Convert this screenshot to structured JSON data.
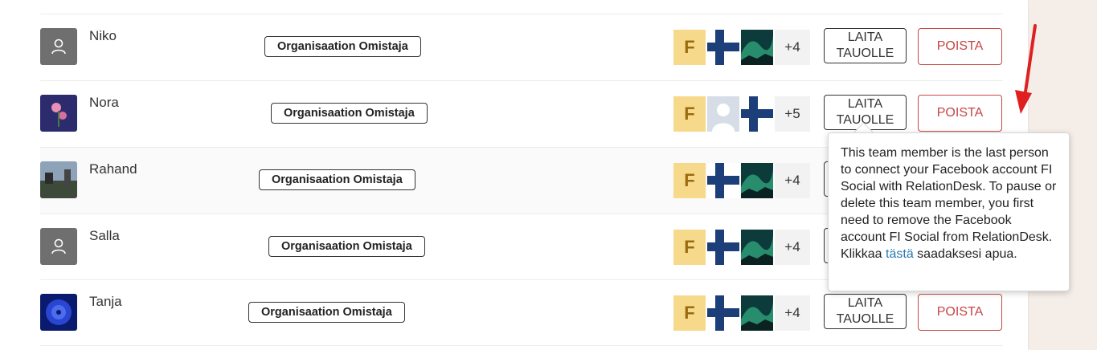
{
  "members": [
    {
      "name": "Niko",
      "avatar": "default-avatar",
      "role": "Organisaation Omistaja",
      "more": "+4",
      "accounts": [
        "facebook-f",
        "finland-flag",
        "aurora-image"
      ],
      "pause_label_1": "LAITA",
      "pause_label_2": "TAUOLLE",
      "delete_label": "POISTA"
    },
    {
      "name": "Nora",
      "avatar": "flower-photo",
      "role": "Organisaation Omistaja",
      "more": "+5",
      "accounts": [
        "facebook-f",
        "person-silhouette",
        "finland-flag"
      ],
      "pause_label_1": "LAITA",
      "pause_label_2": "TAUOLLE",
      "delete_label": "POISTA"
    },
    {
      "name": "Rahand",
      "avatar": "street-photo",
      "role": "Organisaation Omistaja",
      "more": "+4",
      "accounts": [
        "facebook-f",
        "finland-flag",
        "aurora-image"
      ]
    },
    {
      "name": "Salla",
      "avatar": "default-avatar",
      "role": "Organisaation Omistaja",
      "more": "+4",
      "accounts": [
        "facebook-f",
        "finland-flag",
        "aurora-image"
      ]
    },
    {
      "name": "Tanja",
      "avatar": "blue-flower-photo",
      "role": "Organisaation Omistaja",
      "more": "+4",
      "accounts": [
        "facebook-f",
        "finland-flag",
        "aurora-image"
      ],
      "pause_label_1": "LAITA",
      "pause_label_2": "TAUOLLE",
      "delete_label": "POISTA"
    }
  ],
  "tooltip": {
    "text": "This team member is the last person to connect your Facebook account FI Social with RelationDesk. To pause or delete this team member, you first need to remove the Facebook account FI Social from RelationDesk. Klikkaa",
    "link": "tästä",
    "suffix": "saadaksesi apua."
  },
  "colors": {
    "delete": "#c74545",
    "facebook_tile": "#f7d98c",
    "flag_blue": "#1c3f7a",
    "arrow": "#e02020"
  }
}
